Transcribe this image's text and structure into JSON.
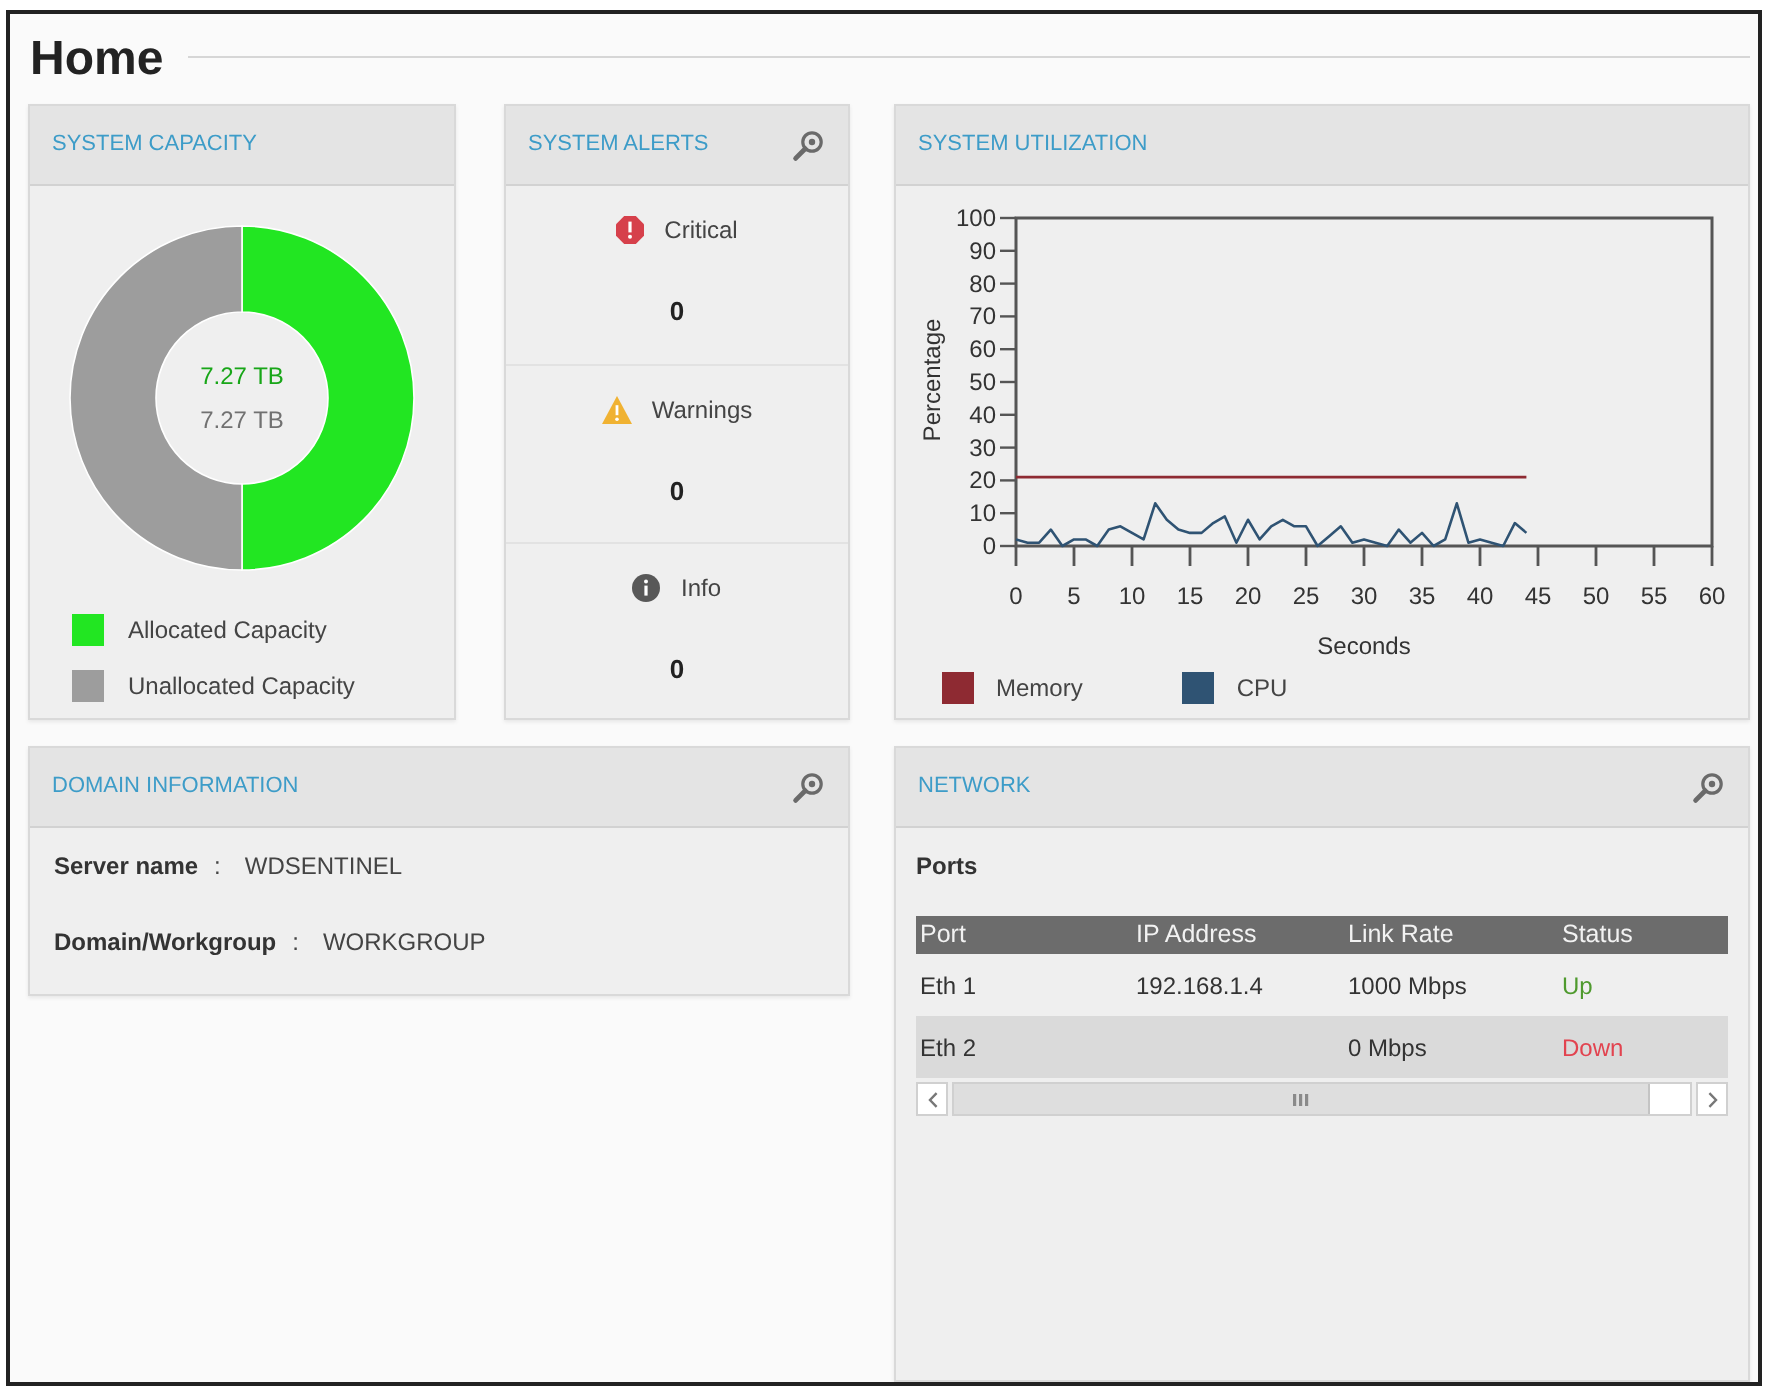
{
  "page": {
    "title": "Home"
  },
  "system_capacity": {
    "title": "SYSTEM CAPACITY",
    "segments": [
      {
        "label": "Allocated Capacity",
        "value_text": "7.27 TB",
        "color": "#22e622"
      },
      {
        "label": "Unallocated Capacity",
        "value_text": "7.27 TB",
        "color": "#9d9d9d"
      }
    ]
  },
  "system_alerts": {
    "title": "SYSTEM ALERTS",
    "items": [
      {
        "kind": "critical",
        "label": "Critical",
        "count": "0"
      },
      {
        "kind": "warning",
        "label": "Warnings",
        "count": "0"
      },
      {
        "kind": "info",
        "label": "Info",
        "count": "0"
      }
    ]
  },
  "system_utilization": {
    "title": "SYSTEM UTILIZATION",
    "chart_data": {
      "type": "line",
      "xlabel": "Seconds",
      "ylabel": "Percentage",
      "x": [
        0,
        1,
        2,
        3,
        4,
        5,
        6,
        7,
        8,
        9,
        10,
        11,
        12,
        13,
        14,
        15,
        16,
        17,
        18,
        19,
        20,
        21,
        22,
        23,
        24,
        25,
        26,
        27,
        28,
        29,
        30,
        31,
        32,
        33,
        34,
        35,
        36,
        37,
        38,
        39,
        40,
        41,
        42,
        43,
        44
      ],
      "series": [
        {
          "name": "Memory",
          "color": "#8e2a32",
          "values": [
            21,
            21,
            21,
            21,
            21,
            21,
            21,
            21,
            21,
            21,
            21,
            21,
            21,
            21,
            21,
            21,
            21,
            21,
            21,
            21,
            21,
            21,
            21,
            21,
            21,
            21,
            21,
            21,
            21,
            21,
            21,
            21,
            21,
            21,
            21,
            21,
            21,
            21,
            21,
            21,
            21,
            21,
            21,
            21,
            21
          ]
        },
        {
          "name": "CPU",
          "color": "#2f5373",
          "values": [
            2,
            1,
            1,
            5,
            0,
            2,
            2,
            0,
            5,
            6,
            4,
            2,
            13,
            8,
            5,
            4,
            4,
            7,
            9,
            1,
            8,
            2,
            6,
            8,
            6,
            6,
            0,
            3,
            6,
            1,
            2,
            1,
            0,
            5,
            1,
            4,
            0,
            2,
            13,
            1,
            2,
            1,
            0,
            7,
            4
          ]
        }
      ],
      "xlim": [
        0,
        60
      ],
      "ylim": [
        0,
        100
      ],
      "xticks": [
        0,
        5,
        10,
        15,
        20,
        25,
        30,
        35,
        40,
        45,
        50,
        55,
        60
      ],
      "yticks": [
        0,
        10,
        20,
        30,
        40,
        50,
        60,
        70,
        80,
        90,
        100
      ],
      "legend": "bottom"
    }
  },
  "domain_information": {
    "title": "DOMAIN INFORMATION",
    "fields": [
      {
        "label": "Server name",
        "separator": ":",
        "value": "WDSENTINEL"
      },
      {
        "label": "Domain/Workgroup",
        "separator": ":",
        "value": "WORKGROUP"
      }
    ]
  },
  "network": {
    "title": "NETWORK",
    "subtitle": "Ports",
    "table": {
      "columns": [
        "Port",
        "IP Address",
        "Link Rate",
        "Status"
      ],
      "rows": [
        {
          "port": "Eth 1",
          "ip_address": "192.168.1.4",
          "link_rate": "1000 Mbps",
          "status": "Up",
          "color": "#4f9a2e",
          "selected": false
        },
        {
          "port": "Eth 2",
          "link_rate": "0 Mbps",
          "status": "Down",
          "color": "#e2434f",
          "selected": true
        }
      ]
    }
  }
}
